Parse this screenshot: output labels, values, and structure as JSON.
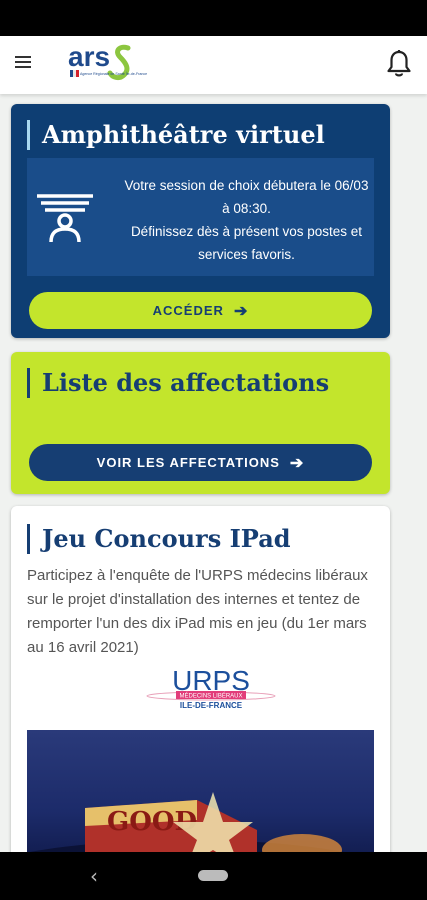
{
  "app": {
    "logo_text": "ars",
    "logo_subtitle": "Agence Régionale de Santé Île-de-France"
  },
  "cards": {
    "amphi": {
      "title": "Amphithéâtre virtuel",
      "session_line1": "Votre session de choix débutera le 06/03 à 08:30.",
      "session_line2": "Définissez dès à présent vos postes et services favoris.",
      "button_label": "ACCÉDER",
      "arrow": "➔"
    },
    "liste": {
      "title": "Liste des affectations",
      "button_label": "VOIR LES AFFECTATIONS",
      "arrow": "➔"
    },
    "jeu": {
      "title": "Jeu Concours IPad",
      "text": "Participez à l'enquête de l'URPS médecins libéraux sur le projet d'installation des internes et tentez de remporter l'un des dix iPad mis en jeu (du 1er mars au 16 avril 2021)",
      "urps_logo": "URPS",
      "urps_logo_band": "MÉDECINS LIBÉRAUX",
      "urps_logo_region": "ILE-DE-FRANCE",
      "photo_text": "GOOD"
    }
  },
  "colors": {
    "navy": "#163e73",
    "lime": "#c3e52c",
    "ars_blue": "#1f4a8c",
    "ars_green": "#8cc63f"
  },
  "icons": {
    "menu": "hamburger-menu-icon",
    "bell": "notification-bell-icon",
    "amphi": "amphitheatre-icon",
    "back": "‹"
  }
}
